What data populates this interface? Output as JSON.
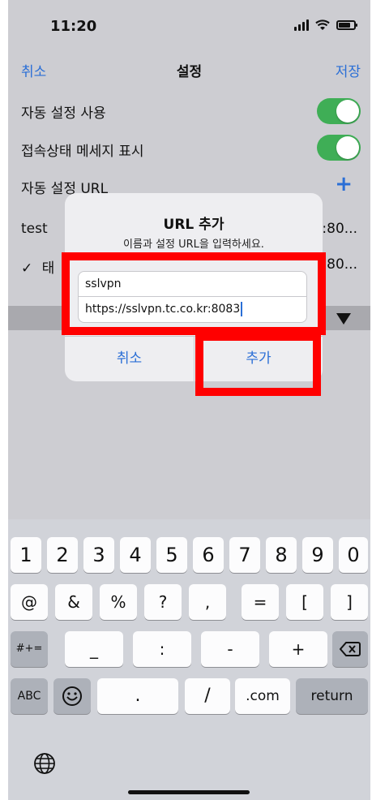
{
  "status": {
    "time": "11:20"
  },
  "nav": {
    "left": "취소",
    "title": "설정",
    "right": "저장"
  },
  "settings": {
    "auto_setting_label": "자동 설정 사용",
    "status_msg_label": "접속상태 메세지 표시",
    "auto_url_label": "자동 설정 URL",
    "plus": "+"
  },
  "list": [
    {
      "name": "test",
      "trail": ":80..."
    },
    {
      "check": "✓",
      "name": "태",
      "trail": ":80..."
    }
  ],
  "dialog": {
    "title": "URL 추가",
    "message": "이름과 설정 URL을 입력하세요.",
    "name_value": "sslvpn",
    "url_value": "https://sslvpn.tc.co.kr:8083",
    "cancel": "취소",
    "add": "추가"
  },
  "keyboard": {
    "row1": [
      "1",
      "2",
      "3",
      "4",
      "5",
      "6",
      "7",
      "8",
      "9",
      "0"
    ],
    "row2": [
      "@",
      "&",
      "%",
      "?",
      ",",
      "=",
      "[",
      "]"
    ],
    "row3_mode": "#+=",
    "row3": [
      "_",
      ":",
      "-",
      "+"
    ],
    "row4": {
      "abc": "ABC",
      "dot": ".",
      "slash": "/",
      "com": ".com",
      "return": "return"
    }
  },
  "colors": {
    "accent": "#2b6fd6",
    "toggle_on": "#3fae56",
    "highlight": "#ff0000"
  }
}
